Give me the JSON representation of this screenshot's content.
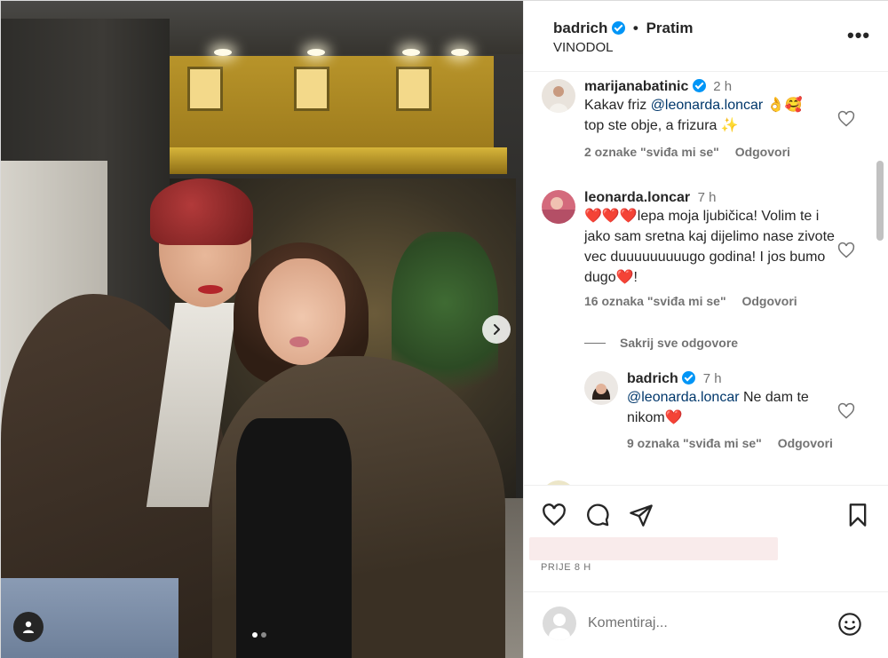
{
  "post": {
    "username": "badrich",
    "follow_label": "Pratim",
    "separator": "•",
    "location": "VINODOL",
    "more_icon": "more-horizontal-icon",
    "more_label": "•••"
  },
  "comments": [
    {
      "username": "marijanabatinic",
      "time": "2 h",
      "text_prefix": "Kakav friz ",
      "mention": "@leonarda.loncar",
      "text_suffix": " 👌🥰",
      "text_line2": "top ste obje, a frizura ✨",
      "likes": "2 oznake \"sviđa mi se\"",
      "reply_label": "Odgovori"
    },
    {
      "username": "leonarda.loncar",
      "time": "7 h",
      "text": "❤️❤️❤️lepa moja ljubičica! Volim te i jako sam sretna kaj dijelimo nase zivote vec duuuuuuuuugo godina! I jos bumo dugo❤️!",
      "likes": "16 oznaka \"sviđa mi se\"",
      "reply_label": "Odgovori"
    }
  ],
  "replies_toggle": "Sakrij sve odgovore",
  "reply": {
    "username": "badrich",
    "time": "7 h",
    "mention": "@leonarda.loncar",
    "text": " Ne dam te nikom❤️",
    "likes": "9 oznaka \"sviđa mi se\"",
    "reply_label": "Odgovori"
  },
  "meta": {
    "time_ago": "PRIJE 8 H"
  },
  "composer": {
    "placeholder": "Komentiraj..."
  },
  "carousel": {
    "slide_count": 2,
    "active_index": 0
  },
  "colors": {
    "verified": "#0095f6",
    "mention": "#00376b",
    "secondary_text": "#737373"
  }
}
